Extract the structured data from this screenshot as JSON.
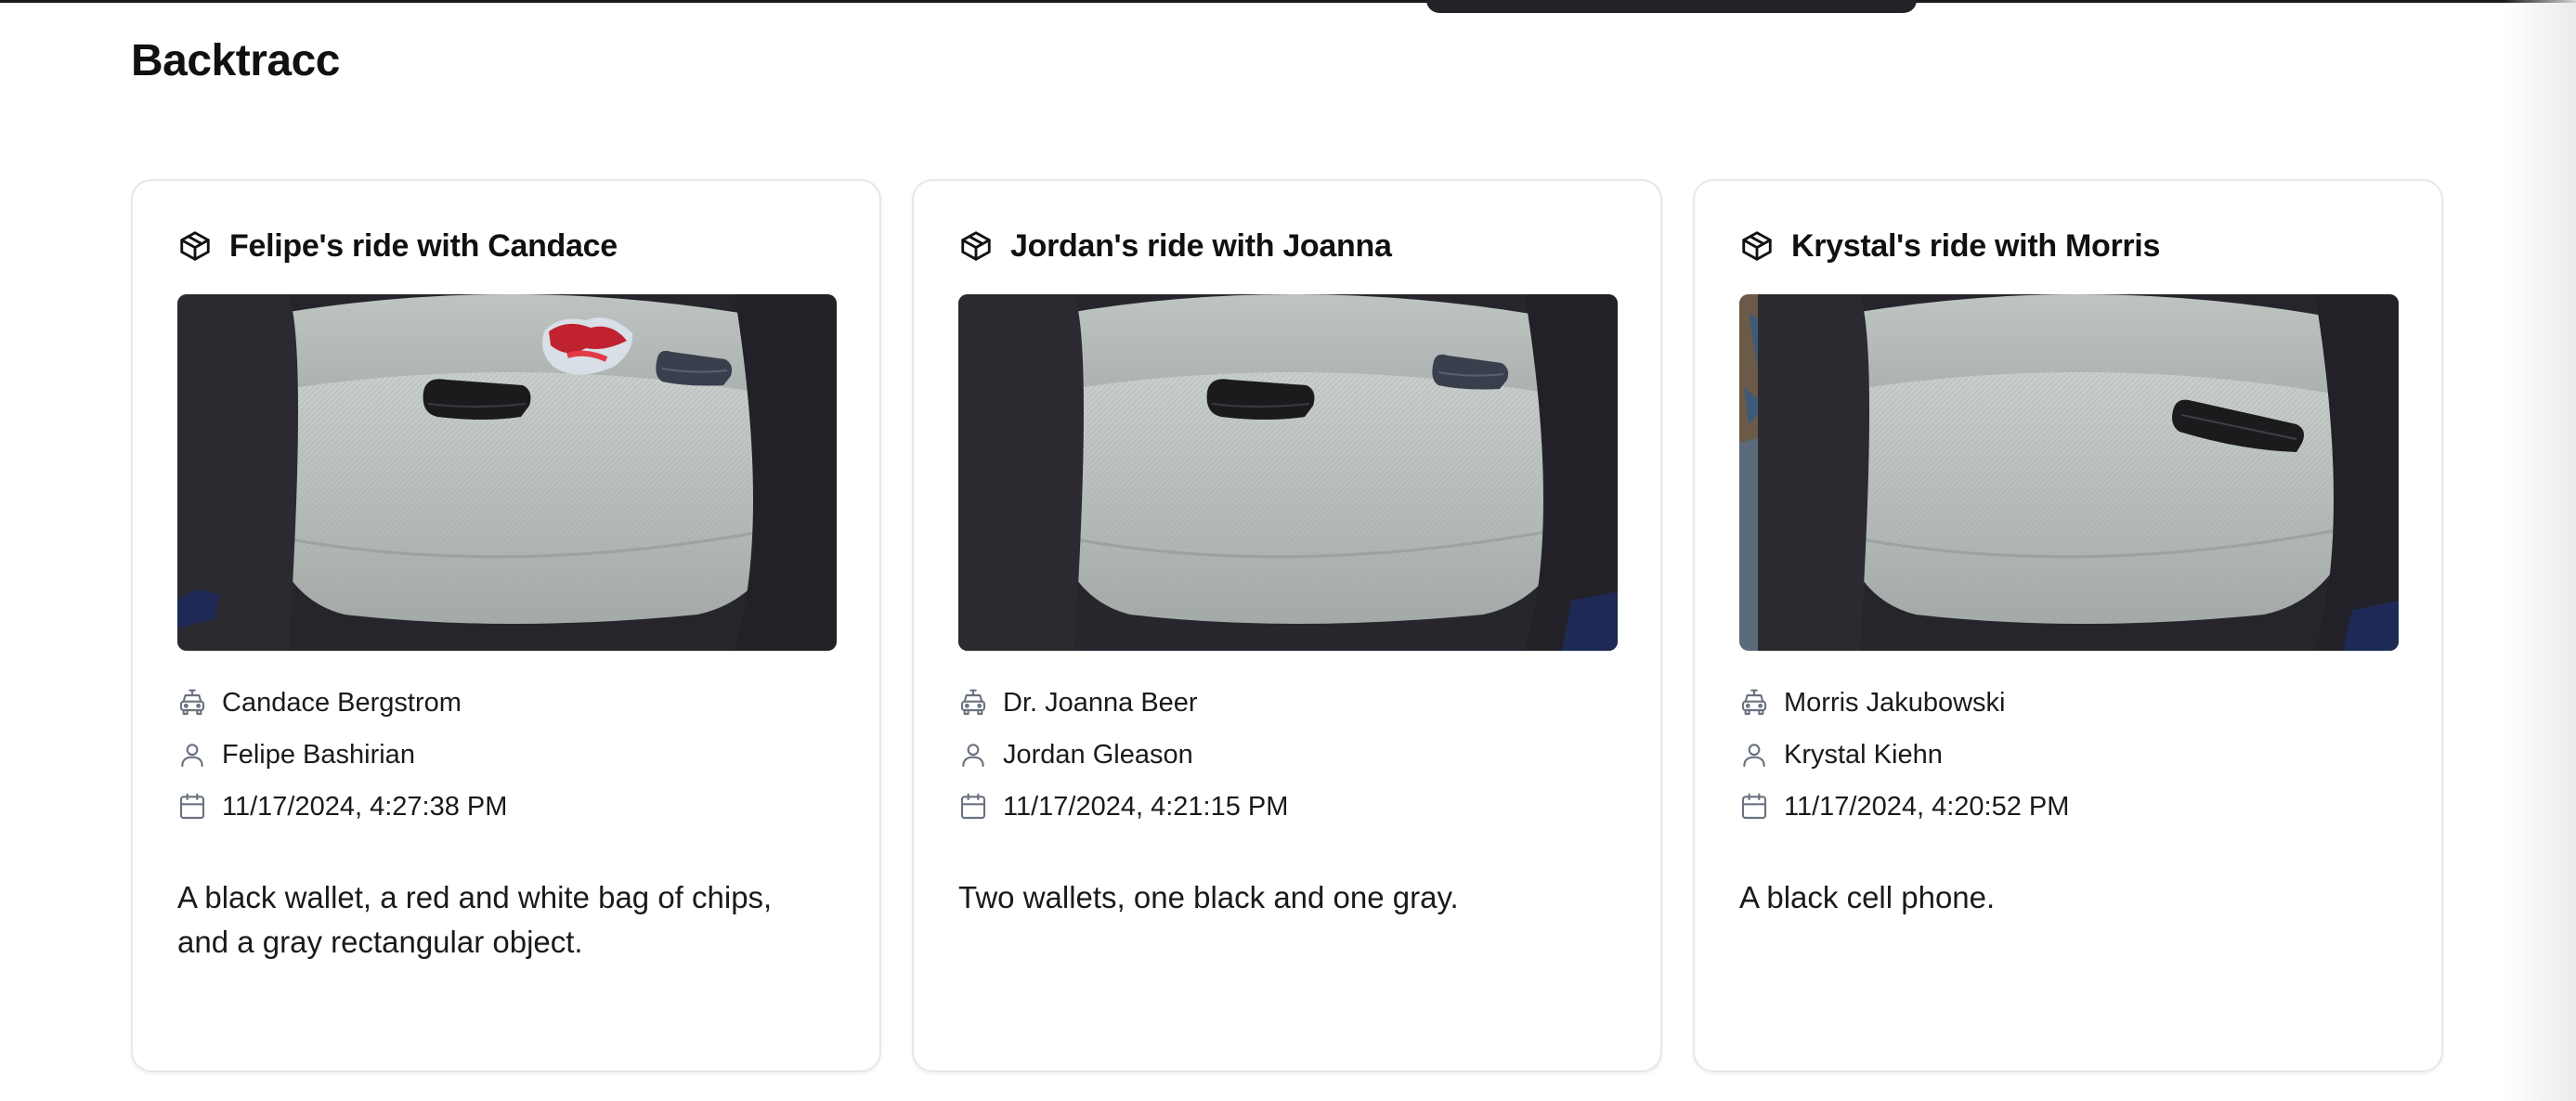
{
  "app": {
    "title": "Backtracc"
  },
  "colors": {
    "background": "#ffffff",
    "card_border": "#e5e7eb",
    "icon_gray": "#6b7280",
    "text": "#111111"
  },
  "icons": {
    "card": "package-icon",
    "driver": "car-icon",
    "rider": "user-icon",
    "date": "calendar-icon"
  },
  "cards": [
    {
      "title": "Felipe's ride with Candace",
      "driver": "Candace Bergstrom",
      "rider": "Felipe Bashirian",
      "datetime": "11/17/2024, 4:27:38 PM",
      "description": "A black wallet, a red and white bag of chips, and a gray rectangular object.",
      "photo_items": [
        "black wallet",
        "red and white bag of chips",
        "gray rectangular object"
      ]
    },
    {
      "title": "Jordan's ride with Joanna",
      "driver": "Dr. Joanna Beer",
      "rider": "Jordan Gleason",
      "datetime": "11/17/2024, 4:21:15 PM",
      "description": "Two wallets, one black and one gray.",
      "photo_items": [
        "black wallet",
        "gray wallet"
      ]
    },
    {
      "title": "Krystal's ride with Morris",
      "driver": "Morris Jakubowski",
      "rider": "Krystal Kiehn",
      "datetime": "11/17/2024, 4:20:52 PM",
      "description": "A black cell phone.",
      "photo_items": [
        "black cell phone"
      ]
    }
  ]
}
